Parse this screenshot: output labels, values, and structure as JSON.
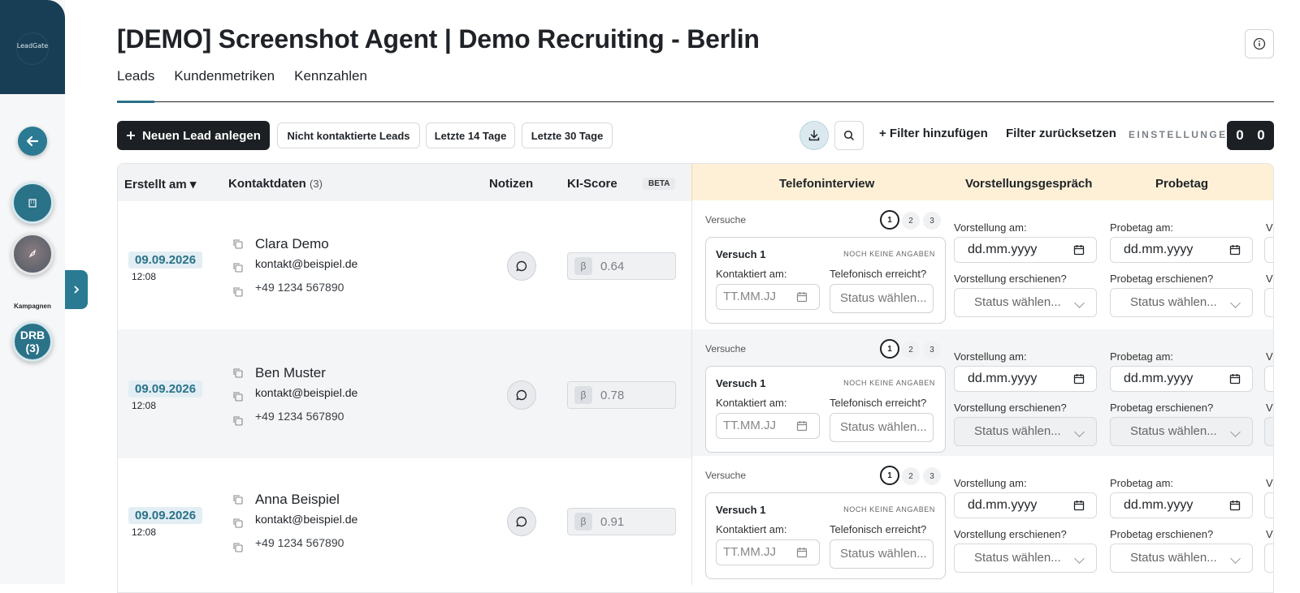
{
  "sidebar": {
    "logo": "LeadGate",
    "campaigns_label": "Kampagnen",
    "campaign_badge_line1": "DRB",
    "campaign_badge_line2": "(3)"
  },
  "header": {
    "title": "[DEMO] Screenshot Agent | Demo Recruiting - Berlin"
  },
  "tabs": [
    {
      "label": "Leads",
      "active": true
    },
    {
      "label": "Kundenmetriken",
      "active": false
    },
    {
      "label": "Kennzahlen",
      "active": false
    }
  ],
  "toolbar": {
    "new_lead": "Neuen Lead anlegen",
    "filter_chips": [
      "Nicht kontaktierte Leads",
      "Letzte 14 Tage",
      "Letzte 30 Tage"
    ],
    "add_filter": "+ Filter hinzufügen",
    "reset_filter": "Filter zurücksetzen",
    "settings": "EINSTELLUNGEN",
    "counter": [
      "0",
      "0"
    ]
  },
  "table": {
    "headers": {
      "created": "Erstellt am ▾",
      "contact": "Kontaktdaten",
      "contact_count": "(3)",
      "notes": "Notizen",
      "score": "KI-Score",
      "beta": "BETA",
      "phone_interview": "Telefoninterview",
      "interview": "Vorstellungsgespräch",
      "trial_day": "Probetag"
    },
    "labels": {
      "versuche": "Versuche",
      "attempt_numbers": [
        "1",
        "2",
        "3"
      ],
      "attempt_title": "Versuch 1",
      "no_info": "NOCH KEINE ANGABEN",
      "contacted_at": "Kontaktiert am:",
      "reached_phone": "Telefonisch erreicht?",
      "date_placeholder": "TT.MM.JJ",
      "status_placeholder": "Status wählen...",
      "interview_at": "Vorstellung am:",
      "interview_showed": "Vorstellung erschienen?",
      "trial_at": "Probetag am:",
      "trial_showed": "Probetag erschienen?",
      "date_format": "dd.mm.yyyy",
      "beta_symbol": "β",
      "edge_label": "V"
    },
    "rows": [
      {
        "date": "09.09.2026",
        "time": "12:08",
        "name": "Clara Demo",
        "email": "kontakt@beispiel.de",
        "phone": "+49 1234 567890",
        "score": "0.64"
      },
      {
        "date": "09.09.2026",
        "time": "12:08",
        "name": "Ben Muster",
        "email": "kontakt@beispiel.de",
        "phone": "+49 1234 567890",
        "score": "0.78"
      },
      {
        "date": "09.09.2026",
        "time": "12:08",
        "name": "Anna Beispiel",
        "email": "kontakt@beispiel.de",
        "phone": "+49 1234 567890",
        "score": "0.91"
      }
    ]
  }
}
